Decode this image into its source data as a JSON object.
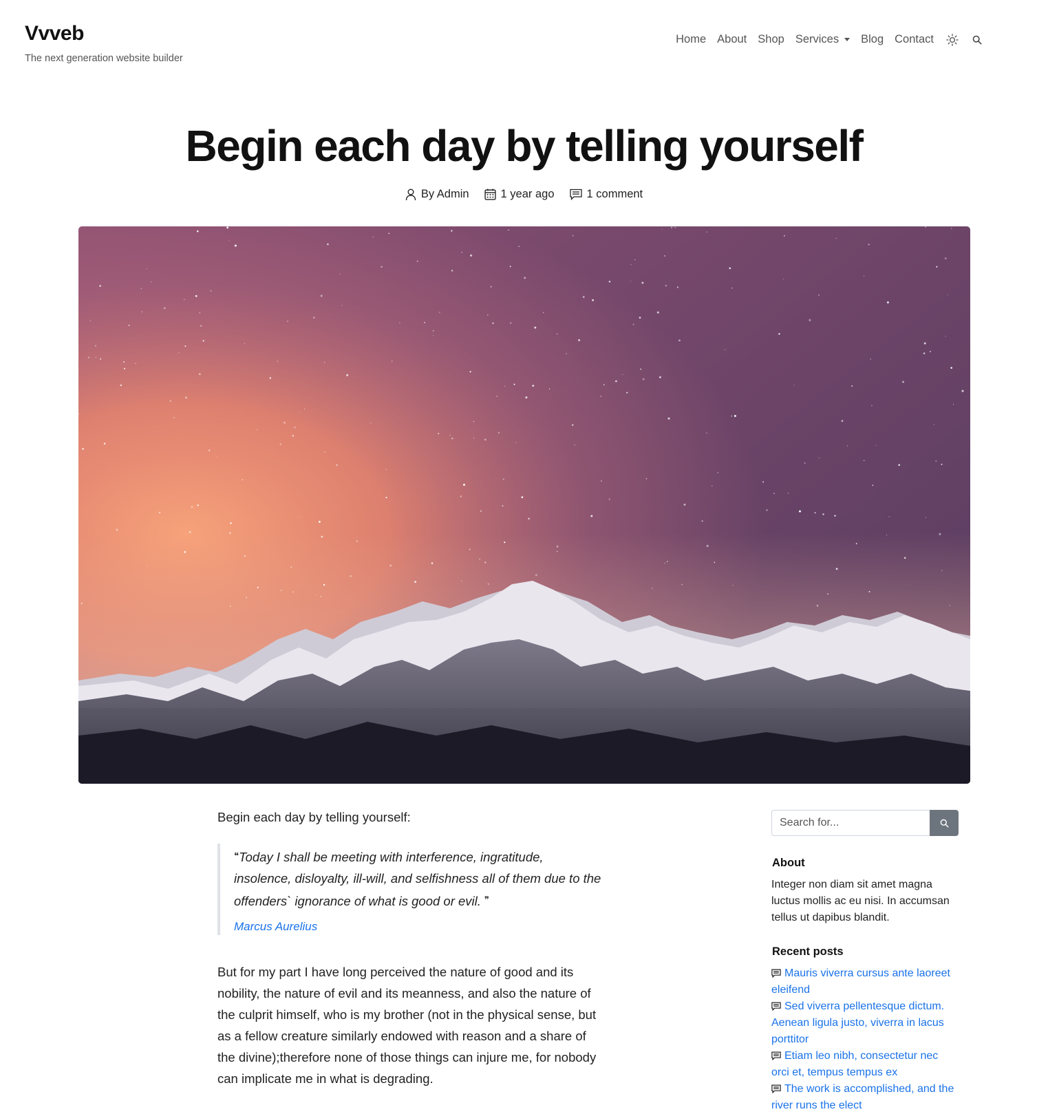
{
  "header": {
    "brand": "Vvveb",
    "tagline": "The next generation website builder",
    "nav": [
      {
        "label": "Home"
      },
      {
        "label": "About"
      },
      {
        "label": "Shop"
      },
      {
        "label": "Services"
      },
      {
        "label": "Blog"
      },
      {
        "label": "Contact"
      }
    ],
    "theme_icon": "sun-icon",
    "search_icon": "search-icon"
  },
  "post": {
    "title": "Begin each day by telling yourself",
    "meta": {
      "author": "By Admin",
      "date": "1 year ago",
      "comments": "1 comment"
    },
    "image_description": "starry-sky-mountains",
    "lead": "Begin each day by telling yourself:",
    "quote": {
      "text": "Today I shall be meeting with interference, ingratitude, insolence, disloyalty, ill-will, and selfishness all of them due to the offenders` ignorance of what is good or evil.",
      "author": "Marcus Aurelius"
    },
    "body": "But for my part I have long perceived the nature of good and its nobility, the nature of evil and its meanness, and also the nature of the culprit himself, who is my brother (not in the physical sense, but as a fellow creature similarly endowed with reason and a share of the divine);therefore none of those things can injure me, for nobody can implicate me in what is degrading."
  },
  "sidebar": {
    "search": {
      "placeholder": "Search for..."
    },
    "about": {
      "title": "About",
      "text": "Integer non diam sit amet magna luctus mollis ac eu nisi. In accumsan tellus ut dapibus blandit."
    },
    "recent": {
      "title": "Recent posts",
      "items": [
        {
          "label": "Mauris viverra cursus ante laoreet eleifend"
        },
        {
          "label": "Sed viverra pellentesque dictum. Aenean ligula justo, viverra in lacus porttitor"
        },
        {
          "label": "Etiam leo nibh, consectetur nec orci et, tempus tempus ex"
        },
        {
          "label": "The work is accomplished, and the river runs the elect"
        }
      ]
    }
  },
  "colors": {
    "link": "#1a73e8",
    "search_button": "#6c757d",
    "sky_top": "#5a3a5e",
    "sky_glow": "#f08a6a"
  }
}
